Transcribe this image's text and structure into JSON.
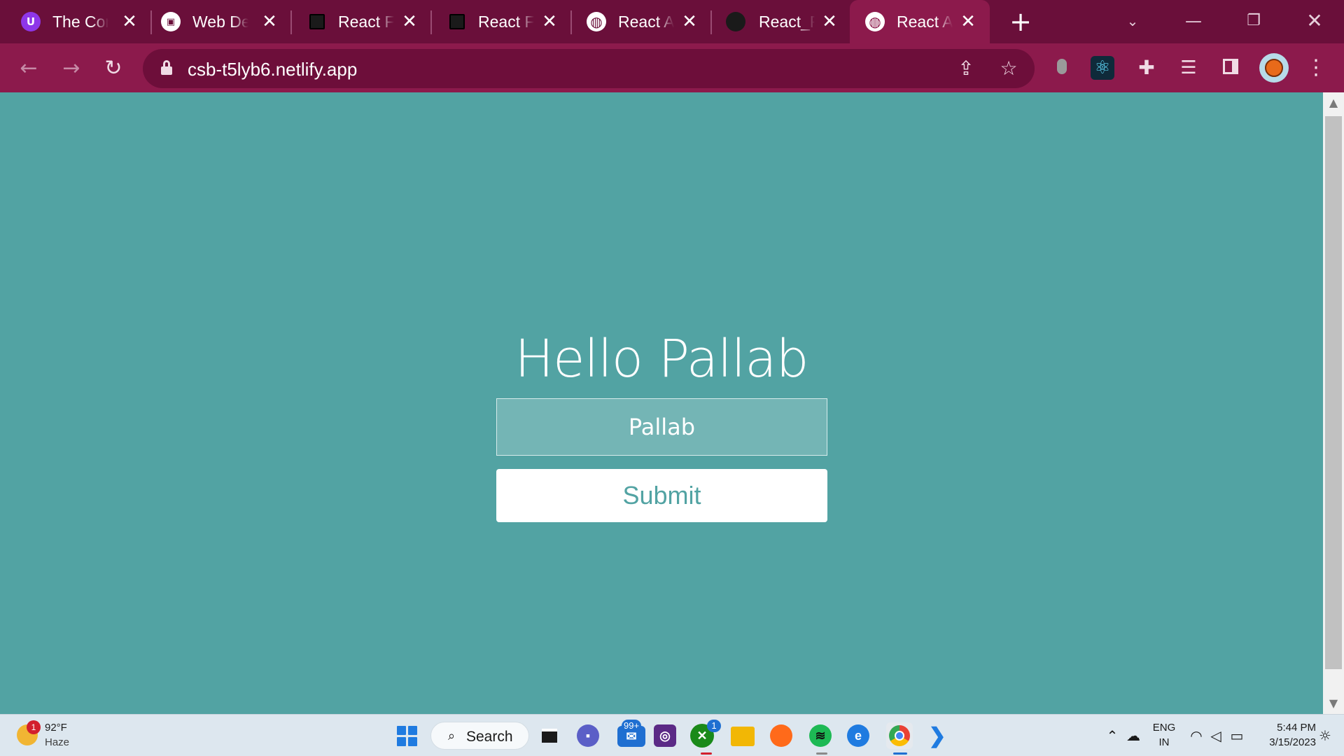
{
  "browser": {
    "tabs": [
      {
        "title": "The Cor",
        "icon": "upgrad-icon",
        "color": "#8e36e8",
        "glyph": "U"
      },
      {
        "title": "Web De",
        "icon": "beer-mug-icon",
        "color": "#ffffff",
        "glyph": "▣"
      },
      {
        "title": "React Fo",
        "icon": "codesandbox-icon",
        "color": "#1a1a1a",
        "glyph": ""
      },
      {
        "title": "React Fo",
        "icon": "codesandbox-icon",
        "color": "#1a1a1a",
        "glyph": ""
      },
      {
        "title": "React Ap",
        "icon": "globe-icon",
        "color": "#ffffff",
        "glyph": "◍"
      },
      {
        "title": "React_F",
        "icon": "github-icon",
        "color": "#1a1a1a",
        "glyph": "●"
      },
      {
        "title": "React A",
        "icon": "globe-icon",
        "color": "#ffffff",
        "glyph": "◍",
        "active": true
      }
    ],
    "close_glyph": "✕",
    "new_tab_glyph": "+",
    "url": "csb-t5lyb6.netlify.app",
    "accent_dark": "#6a0f3a",
    "accent": "#8c1a4c"
  },
  "page": {
    "greeting": "Hello Pallab",
    "input_value": "Pallab",
    "submit_label": "Submit",
    "background": "#52a3a3"
  },
  "taskbar": {
    "weather": {
      "temp": "92°F",
      "condition": "Haze",
      "badge": "1"
    },
    "search_label": "Search",
    "mail_badge": "99+",
    "xbox_badge": "1",
    "language": {
      "line1": "ENG",
      "line2": "IN"
    },
    "clock": {
      "time": "5:44 PM",
      "date": "3/15/2023"
    }
  }
}
